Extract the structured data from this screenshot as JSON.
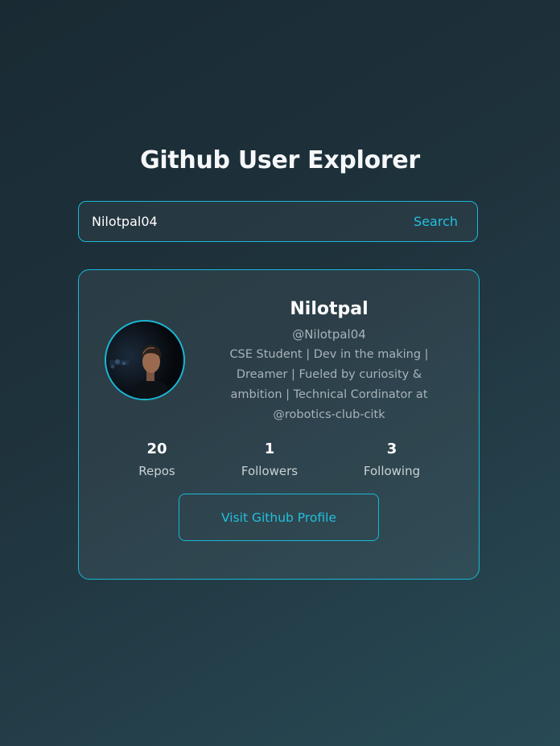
{
  "page": {
    "title": "Github User Explorer"
  },
  "search": {
    "value": "Nilotpal04",
    "button_label": "Search"
  },
  "profile": {
    "name": "Nilotpal",
    "login": "@Nilotpal04",
    "bio": "CSE Student | Dev in the making | Dreamer | Fueled by curiosity & ambition | Technical Cordinator at @robotics-club-citk",
    "avatar_icon": "user-photo",
    "stats": [
      {
        "value": "20",
        "label": "Repos"
      },
      {
        "value": "1",
        "label": "Followers"
      },
      {
        "value": "3",
        "label": "Following"
      }
    ],
    "visit_label": "Visit Github Profile"
  },
  "colors": {
    "accent": "#19b8d6",
    "background_start": "#192a33",
    "background_end": "#284a55",
    "muted_text": "#a7b3b8"
  }
}
